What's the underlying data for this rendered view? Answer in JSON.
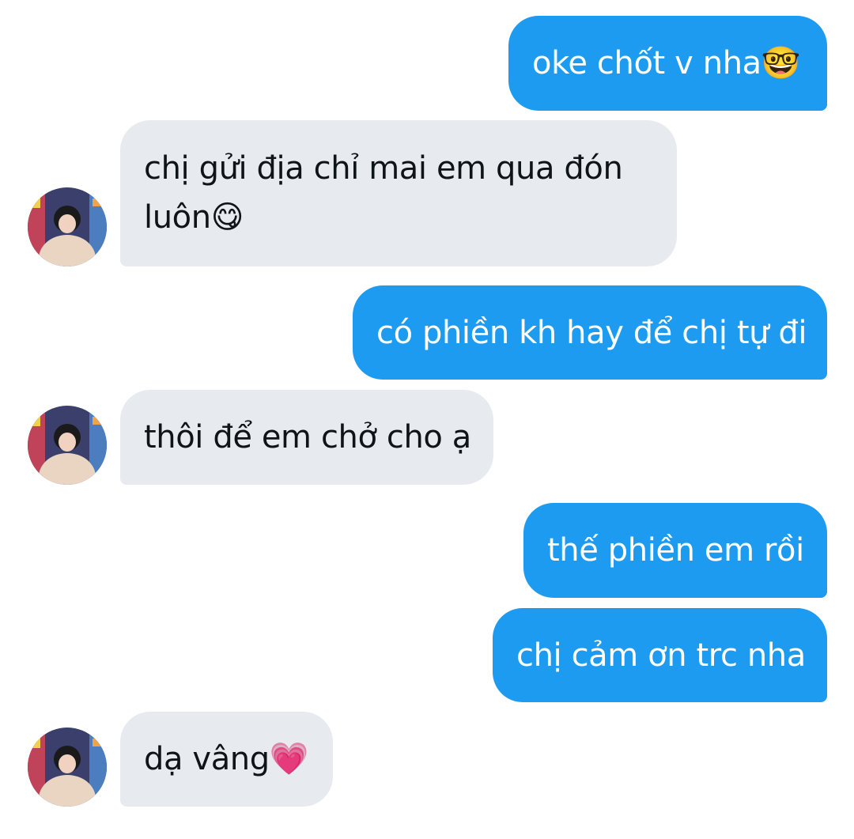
{
  "messages": [
    {
      "direction": "sent",
      "text": "oke chốt v nha",
      "emoji": "🤓"
    },
    {
      "direction": "received",
      "line1": "chị gửi địa chỉ mai em qua đón",
      "line2": "luôn",
      "emoji": "😋"
    },
    {
      "direction": "sent",
      "text": "có phiền kh hay để chị tự đi"
    },
    {
      "direction": "received",
      "text": "thôi để em chở cho ạ"
    },
    {
      "direction": "sent",
      "text": "thế phiền em rồi"
    },
    {
      "direction": "sent",
      "text": "chị cảm ơn trc nha"
    },
    {
      "direction": "received",
      "text": "dạ vâng",
      "emoji": "💗"
    }
  ],
  "colors": {
    "sent_bubble": "#1d9bf0",
    "received_bubble": "#e7ebf0",
    "sent_text": "#ffffff",
    "received_text": "#0f1419"
  }
}
